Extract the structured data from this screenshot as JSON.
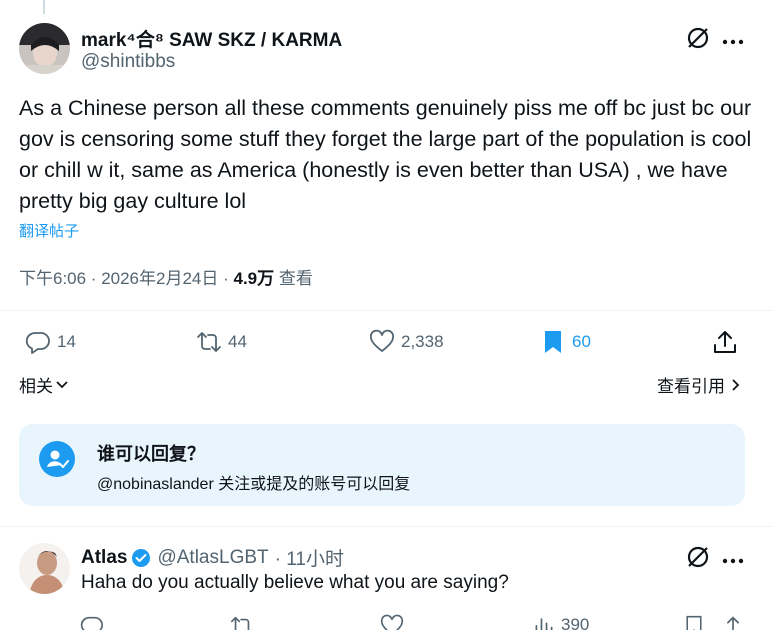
{
  "main_tweet": {
    "display_name": "mark⁴合⁸ SAW SKZ / KARMA",
    "handle": "@shintibbs",
    "text": "As a Chinese person all these comments genuinely piss me off bc just bc our gov is censoring some stuff they forget the large part of the population is cool or chill w it, same as America (honestly is even better than USA) , we have pretty big gay culture lol",
    "translate_label": "翻译帖子",
    "time": "下午6:06 · 2026年2月24日 · ",
    "views_count": "4.9万",
    "views_label": " 查看",
    "stats": {
      "replies": "14",
      "reposts": "44",
      "likes": "2,338",
      "bookmarks": "60"
    },
    "related_label": "相关",
    "quotes_label": "查看引用"
  },
  "reply_restriction": {
    "title": "谁可以回复？",
    "subtitle": "@nobinaslander 关注或提及的账号可以回复"
  },
  "reply_tweet": {
    "display_name": "Atlas",
    "handle": "@AtlasLGBT",
    "time": "· 11小时",
    "text": "Haha do you actually believe what you are saying?",
    "views": "390"
  },
  "colors": {
    "accent": "#1d9bf0",
    "secondary_text": "#536471",
    "bookmark_active": "#1d9bf0",
    "verified": "#1d9bf0"
  }
}
